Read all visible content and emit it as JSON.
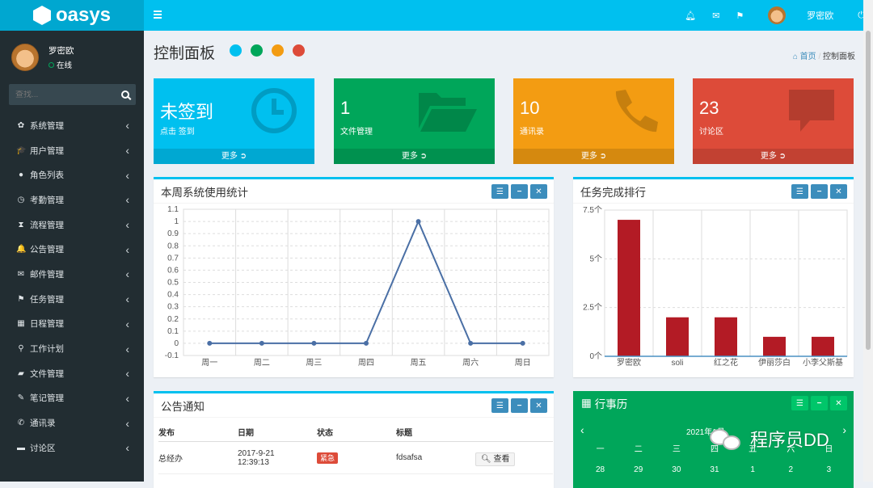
{
  "app": {
    "logo": "oasys"
  },
  "user": {
    "name": "罗密欧",
    "status": "在线"
  },
  "search": {
    "placeholder": "查找..."
  },
  "menu": [
    {
      "label": "系统管理",
      "icon": "gear-icon",
      "glyph": "✿"
    },
    {
      "label": "用户管理",
      "icon": "graduation-cap-icon",
      "glyph": "🎓"
    },
    {
      "label": "角色列表",
      "icon": "user-icon",
      "glyph": "●"
    },
    {
      "label": "考勤管理",
      "icon": "clock-icon",
      "glyph": "◷"
    },
    {
      "label": "流程管理",
      "icon": "hourglass-icon",
      "glyph": "⧗"
    },
    {
      "label": "公告管理",
      "icon": "bell-icon",
      "glyph": "🔔"
    },
    {
      "label": "邮件管理",
      "icon": "envelope-icon",
      "glyph": "✉"
    },
    {
      "label": "任务管理",
      "icon": "flag-icon",
      "glyph": "⚑"
    },
    {
      "label": "日程管理",
      "icon": "calendar-icon",
      "glyph": "▦"
    },
    {
      "label": "工作计划",
      "icon": "person-icon",
      "glyph": "⚲"
    },
    {
      "label": "文件管理",
      "icon": "folder-icon",
      "glyph": "▰"
    },
    {
      "label": "笔记管理",
      "icon": "edit-icon",
      "glyph": "✎"
    },
    {
      "label": "通讯录",
      "icon": "phone-icon",
      "glyph": "✆"
    },
    {
      "label": "讨论区",
      "icon": "comment-icon",
      "glyph": "▬"
    }
  ],
  "topbar": {
    "user_name": "罗密欧"
  },
  "page": {
    "title": "控制面板",
    "breadcrumb_home": "首页",
    "breadcrumb_sep": "/",
    "breadcrumb_current": "控制面板",
    "theme_colors": [
      "#00c0ef",
      "#00a65a",
      "#f39c12",
      "#dd4b39"
    ]
  },
  "boxes": [
    {
      "value": "未签到",
      "label": "点击 签到",
      "more": "更多",
      "color": "#00c0ef",
      "icon": "clock-icon"
    },
    {
      "value": "1",
      "label": "文件管理",
      "more": "更多",
      "color": "#00a65a",
      "icon": "folder-open-icon"
    },
    {
      "value": "10",
      "label": "通讯录",
      "more": "更多",
      "color": "#f39c12",
      "icon": "phone-icon"
    },
    {
      "value": "23",
      "label": "讨论区",
      "more": "更多",
      "color": "#dd4b39",
      "icon": "comment-icon"
    }
  ],
  "line_panel": {
    "title": "本周系统使用统计"
  },
  "bar_panel": {
    "title": "任务完成排行"
  },
  "notice_panel": {
    "title": "公告通知",
    "headers": [
      "发布",
      "日期",
      "状态",
      "标题"
    ],
    "rows": [
      {
        "publisher": "总经办",
        "date": "2017-9-21",
        "time": "12:39:13",
        "status": "紧急",
        "subject": "fdsafsa",
        "action": "查看"
      }
    ]
  },
  "calendar": {
    "title": "行事历",
    "year_month": "2021年1月",
    "weekdays": [
      "一",
      "二",
      "三",
      "四",
      "五",
      "六",
      "日"
    ],
    "days": [
      "28",
      "29",
      "30",
      "31",
      "1",
      "2",
      "3"
    ]
  },
  "watermark": {
    "text": "程序员DD"
  },
  "chart_data": [
    {
      "type": "line",
      "categories": [
        "周一",
        "周二",
        "周三",
        "周四",
        "周五",
        "周六",
        "周日"
      ],
      "values": [
        0,
        0,
        0,
        0,
        1,
        0,
        0
      ],
      "ylim": [
        -0.1,
        1.1
      ],
      "yticks": [
        "-0.1",
        "0",
        "0.1",
        "0.2",
        "0.3",
        "0.4",
        "0.5",
        "0.6",
        "0.7",
        "0.8",
        "0.9",
        "1",
        "1.1"
      ],
      "color": "#4a6fa5"
    },
    {
      "type": "bar",
      "categories": [
        "罗密欧",
        "soli",
        "红之花",
        "伊丽莎白",
        "小李父斯基"
      ],
      "values": [
        7,
        2,
        2,
        1,
        1
      ],
      "ylim": [
        0,
        7.5
      ],
      "yticks": [
        "0个",
        "2.5个",
        "5个",
        "7.5个"
      ],
      "color": "#b31b25"
    }
  ]
}
